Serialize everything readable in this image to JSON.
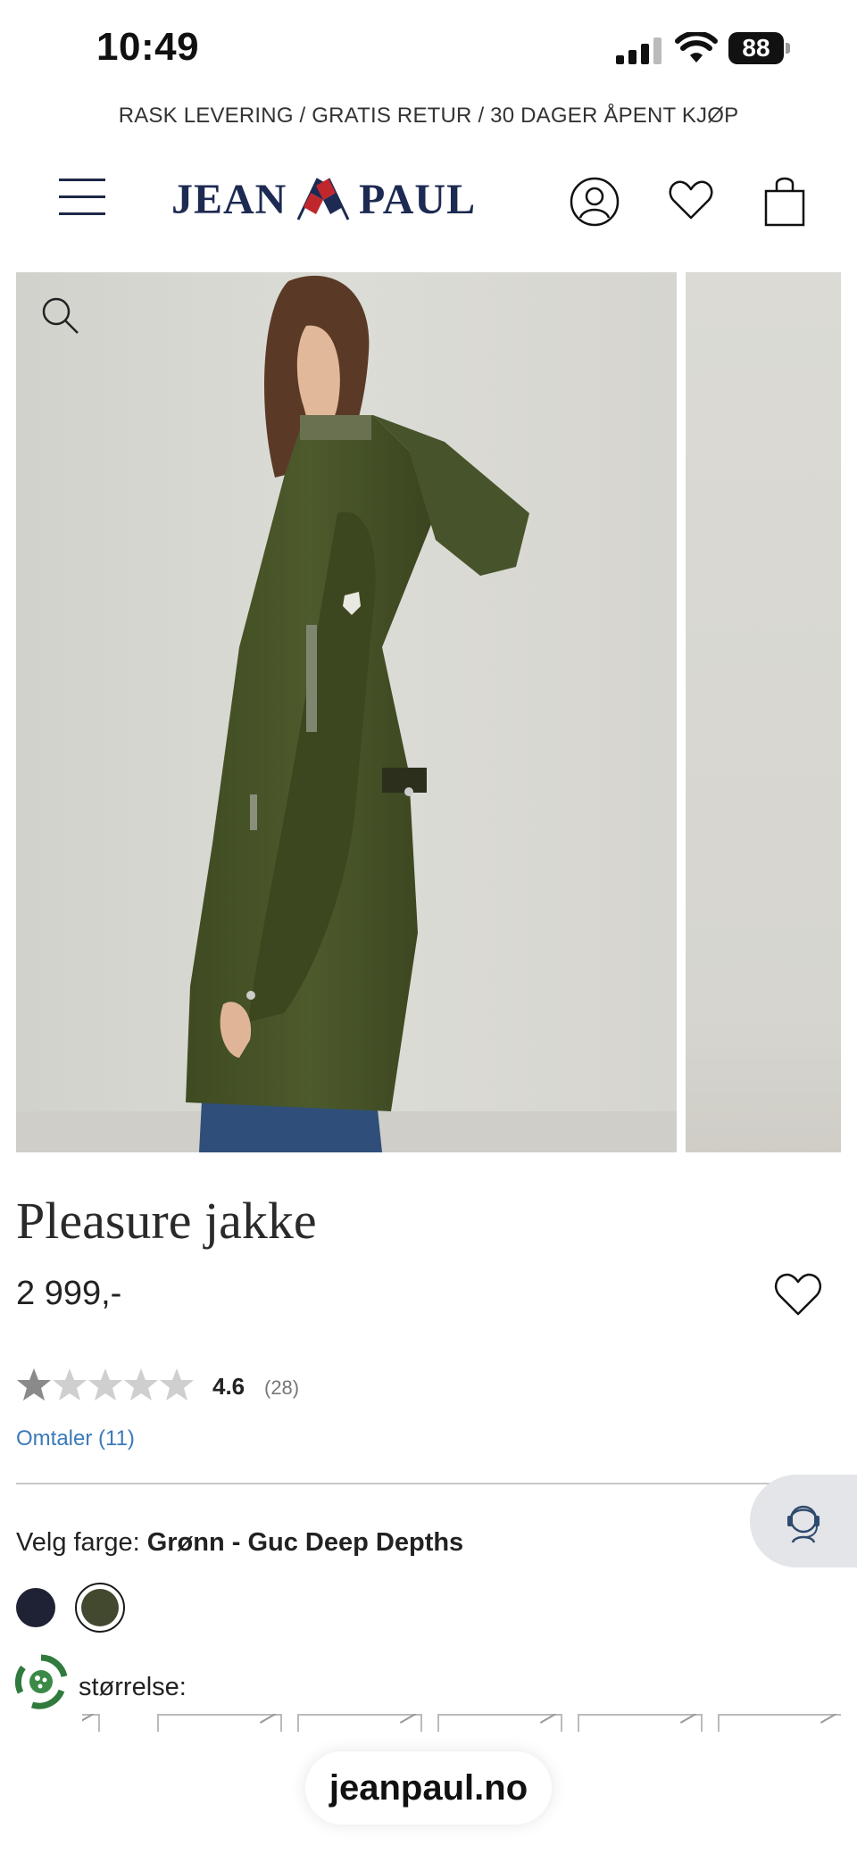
{
  "status_bar": {
    "time": "10:49",
    "battery": "88"
  },
  "promo": {
    "text": "RASK LEVERING / GRATIS RETUR / 30 DAGER ÅPENT KJØP"
  },
  "header": {
    "logo_left": "JEAN",
    "logo_right": "PAUL"
  },
  "product": {
    "title": "Pleasure jakke",
    "price": "2 999,-",
    "rating": "4.6",
    "rating_count": "(28)",
    "rating_value": 4.6,
    "reviews_link": "Omtaler (11)",
    "color_label": "Velg farge: ",
    "color_value": "Grønn - Guc Deep Depths",
    "swatches": [
      {
        "name": "navy",
        "color": "#1f2235"
      },
      {
        "name": "green",
        "color": "#43492f",
        "selected": true
      }
    ],
    "size_label": "størrelse:"
  },
  "browser": {
    "url": "jeanpaul.no"
  },
  "colors": {
    "brand_navy": "#1d2a52",
    "link_blue": "#3b7ab8",
    "logo_red": "#c0272d"
  }
}
